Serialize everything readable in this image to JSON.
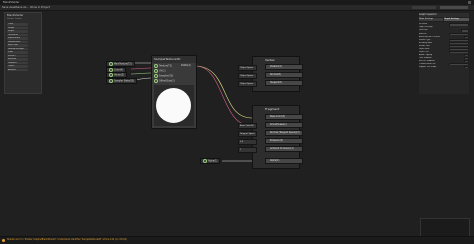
{
  "window": {
    "title": "BlankShader"
  },
  "menubar": {
    "tabs": [
      "Save Asset",
      "Save As...",
      "Show In Project"
    ]
  },
  "blackboard": {
    "title": "BlankShader",
    "subtitle": "Shader Graphs",
    "properties": [
      "Color",
      "Shape",
      "Stripe",
      "Texture2D",
      "MainTexture",
      "Smoothness",
      "BaseColor",
      "NormalStrength",
      "Float",
      "Vector1",
      "Boolean",
      "Gradient",
      "Color2",
      "Amount"
    ]
  },
  "sample_node": {
    "title": "SampleTexture2D",
    "inputs": [
      "Texture(T2)",
      "UV(2)",
      "Sampler(SS)",
      "Offset/Size(2)"
    ],
    "outputs": [
      "RGBA(4)",
      "R(1)",
      "G(1)",
      "B(1)",
      "A(1)"
    ],
    "left_props": [
      "MainTexture(T2)",
      "Color(4)",
      "Vector(2)",
      "Sampler State(SS)"
    ]
  },
  "vertex": {
    "title": "Vertex",
    "rows": [
      {
        "input": "Object Space",
        "label": "Position(3)"
      },
      {
        "input": "Object Space",
        "label": "Normal(3)"
      },
      {
        "input": "Object Space",
        "label": "Tangent(3)"
      }
    ]
  },
  "fragment": {
    "title": "Fragment",
    "rows": [
      {
        "input": "",
        "label": "Base Color(3)"
      },
      {
        "input": "Base Color(4)",
        "label": "Smoothness(1)"
      },
      {
        "input": "Tangent Space",
        "label": "Normal (Tangent Space)(3)"
      },
      {
        "input": "0.5",
        "label": "Emission(3)"
      },
      {
        "input": "1",
        "label": "Ambient Occlusion(1)"
      },
      {
        "input": "Alpha(1)",
        "label": "Alpha(1)"
      }
    ],
    "bottom_prop": "Alpha(1)"
  },
  "rgba_label": "RGBA(4)",
  "inspector": {
    "tabs": [
      "Graph Inspector"
    ],
    "subtabs": [
      "Node Settings",
      "Graph Settings"
    ],
    "rows": [
      "Precision",
      "Target Settings",
      "Universal",
      "Material",
      "Allow Material Override",
      "Surface Type",
      "Blending Mode",
      "Render Face",
      "Depth Write",
      "Depth Test",
      "Alpha Clipping",
      "Cast Shadows",
      "Receive Shadows",
      "Custom Editor GUI",
      "Support VFX Graph"
    ]
  },
  "statusbar": {
    "text": "Shader error in 'Shader Graphs/BlankShader': Undeclared identifier 'SampleTexture2D' at line 142 (on d3d11)"
  },
  "colors": {
    "accent": "#e0a030",
    "wire_green": "#a3d98a",
    "wire_pink": "#d6608a",
    "wire_yellow": "#e2e28a",
    "wire_white": "#dcdcdc"
  }
}
